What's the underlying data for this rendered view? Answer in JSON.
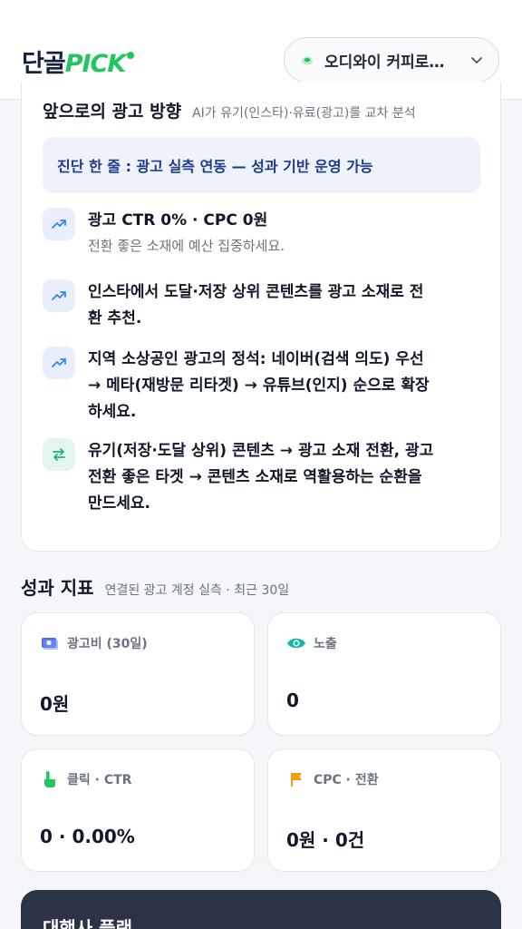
{
  "header": {
    "logo_ko": "단골",
    "logo_pick": "PICK",
    "store_name": "오디와이 커피로…"
  },
  "ad_direction": {
    "title": "앞으로의 광고 방향",
    "subtitle": "AI가 유기(인스타)·유료(광고)를 교차 분석",
    "diagnosis": "진단 한 줄 : 광고 실측 연동 — 성과 기반 운영 가능",
    "tips": [
      {
        "icon": "trend-up-icon",
        "main": "광고 CTR 0% · CPC 0원",
        "sub": "전환 좋은 소재에 예산 집중하세요."
      },
      {
        "icon": "trend-up-icon",
        "main_lines": [
          "인스타에서 도달·저장 상위 콘텐츠를 광고 소재로 전",
          "환 추천."
        ]
      },
      {
        "icon": "trend-up-icon",
        "main_lines": [
          "지역 소상공인 광고의 정석: 네이버(검색 의도) 우선",
          "→ 메타(재방문 리타겟) → 유튜브(인지) 순으로 확장",
          "하세요."
        ]
      },
      {
        "icon": "swap-icon",
        "main_lines": [
          "유기(저장·도달 상위) 콘텐츠 → 광고 소재 전환, 광고",
          "전환 좋은 타겟 → 콘텐츠 소재로 역활용하는 순환을",
          "만드세요."
        ]
      }
    ]
  },
  "kpi": {
    "title": "성과 지표",
    "subtitle": "연결된 광고 계정 실측 · 최근 30일",
    "cards": [
      {
        "icon": "money-icon",
        "label": "광고비 (30일)",
        "value": "0원"
      },
      {
        "icon": "eye-icon",
        "label": "노출",
        "value": "0"
      },
      {
        "icon": "pointer-hand-icon",
        "label": "클릭 · CTR",
        "value": "0 · 0.00%"
      },
      {
        "icon": "flag-icon",
        "label": "CPC · 전환",
        "value": "0원 · 0건"
      }
    ]
  },
  "agency_plan": {
    "title": "대행사 플랜"
  },
  "colors": {
    "brand_green": "#22c55e",
    "navy": "#1e3a8a",
    "dark_card": "#2b3446"
  }
}
